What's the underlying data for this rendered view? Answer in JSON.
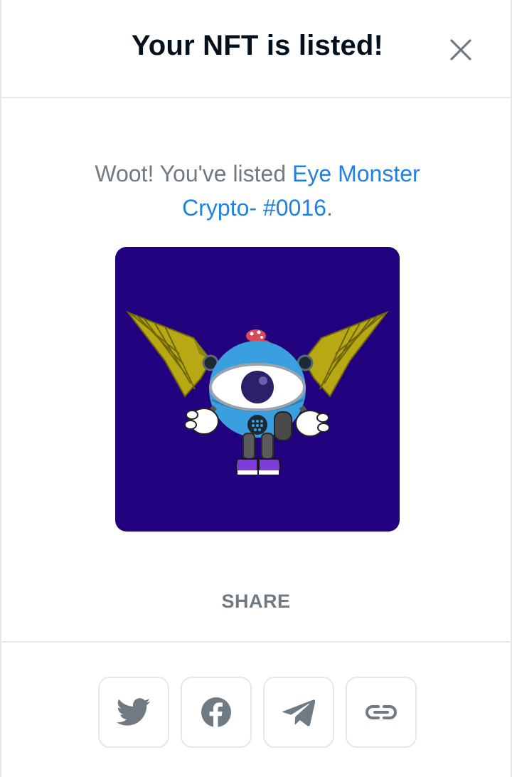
{
  "modal": {
    "title": "Your NFT is listed!",
    "message_prefix": "Woot! You've listed ",
    "nft_name": "Eye Monster Crypto- #0016",
    "message_suffix": ".",
    "share_label": "SHARE"
  },
  "icons": {
    "close": "close-icon",
    "share_buttons": [
      "twitter-icon",
      "facebook-icon",
      "telegram-icon",
      "link-icon"
    ]
  },
  "colors": {
    "title": "#04111d",
    "text_muted": "#707a83",
    "link": "#2081e2",
    "border": "#e5e8eb",
    "image_background": "#22017f",
    "icon": "#707a83"
  }
}
